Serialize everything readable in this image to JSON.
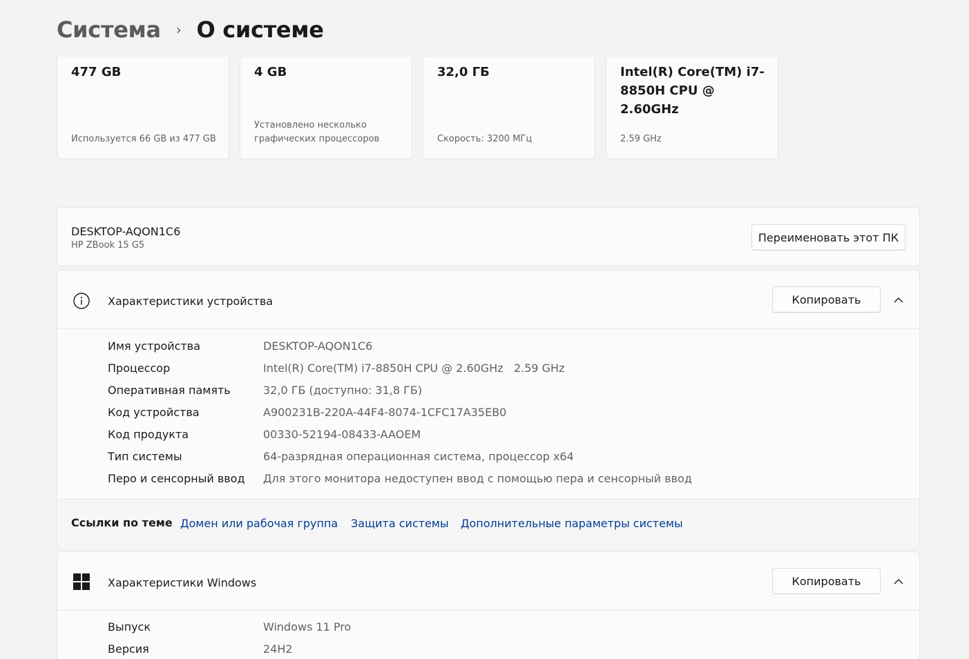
{
  "breadcrumb": {
    "parent": "Система",
    "separator": "›",
    "current": "О системе"
  },
  "spec_cards": [
    {
      "value": "477 GB",
      "sub": "Используется 66 GB из 477 GB"
    },
    {
      "value": "4 GB",
      "sub": "Установлено несколько графических процессоров"
    },
    {
      "value": "32,0 ГБ",
      "sub": "Скорость: 3200 МГц"
    },
    {
      "value": "Intel(R) Core(TM) i7-8850H CPU @ 2.60GHz",
      "sub": "2.59 GHz"
    }
  ],
  "pc": {
    "name": "DESKTOP-AQON1C6",
    "model": "HP ZBook 15 G5",
    "rename_button": "Переименовать этот ПК"
  },
  "device_specs": {
    "title": "Характеристики устройства",
    "copy_button": "Копировать",
    "icon": "info-icon",
    "rows": [
      {
        "label": "Имя устройства",
        "value": "DESKTOP-AQON1C6"
      },
      {
        "label": "Процессор",
        "value": "Intel(R) Core(TM) i7-8850H CPU @ 2.60GHz   2.59 GHz"
      },
      {
        "label": "Оперативная память",
        "value": "32,0 ГБ (доступно: 31,8 ГБ)"
      },
      {
        "label": "Код устройства",
        "value": "A900231B-220A-44F4-8074-1CFC17A35EB0"
      },
      {
        "label": "Код продукта",
        "value": "00330-52194-08433-AAOEM"
      },
      {
        "label": "Тип системы",
        "value": "64-разрядная операционная система, процессор x64"
      },
      {
        "label": "Перо и сенсорный ввод",
        "value": "Для этого монитора недоступен ввод с помощью пера и сенсорный ввод"
      }
    ],
    "related_links": {
      "label": "Ссылки по теме",
      "links": [
        "Домен или рабочая группа",
        "Защита системы",
        "Дополнительные параметры системы"
      ]
    }
  },
  "windows_specs": {
    "title": "Характеристики Windows",
    "copy_button": "Копировать",
    "icon": "windows-logo-icon",
    "rows": [
      {
        "label": "Выпуск",
        "value": "Windows 11 Pro"
      },
      {
        "label": "Версия",
        "value": "24H2"
      }
    ]
  },
  "colors": {
    "background": "#f3f3f3",
    "card": "#fbfbfb",
    "link": "#003e92",
    "secondary_text": "#616161"
  }
}
